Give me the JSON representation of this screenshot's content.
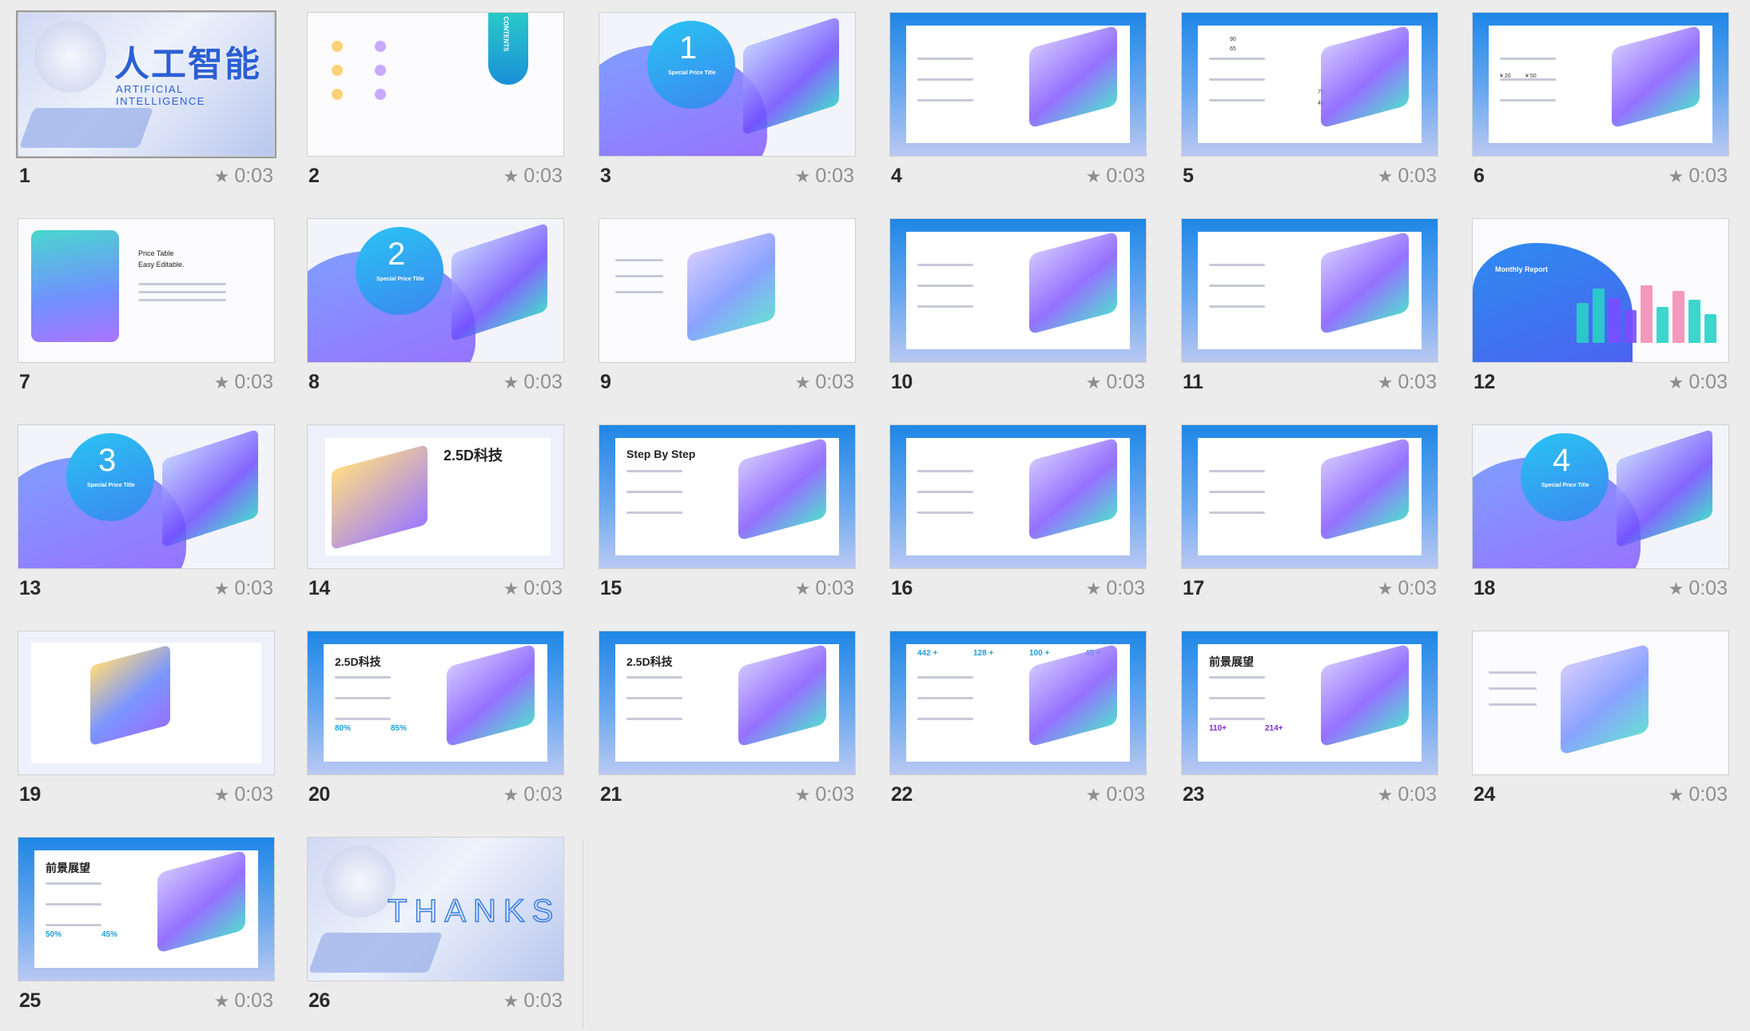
{
  "slides": [
    {
      "number": "1",
      "duration": "0:03",
      "selected": true,
      "title_cn": "人工智能",
      "title_en": "ARTIFICIAL INTELLIGENCE"
    },
    {
      "number": "2",
      "duration": "0:03",
      "contents_label": "CONTENTS"
    },
    {
      "number": "3",
      "duration": "0:03",
      "section_number": "1",
      "section_title": "Special Price Title"
    },
    {
      "number": "4",
      "duration": "0:03"
    },
    {
      "number": "5",
      "duration": "0:03",
      "values": [
        "90",
        "65",
        "70",
        "45"
      ]
    },
    {
      "number": "6",
      "duration": "0:03",
      "prices": [
        "¥ 20",
        "¥ 50"
      ]
    },
    {
      "number": "7",
      "duration": "0:03",
      "heading": "Price Table",
      "subheading": "Easy Editable."
    },
    {
      "number": "8",
      "duration": "0:03",
      "section_number": "2",
      "section_title": "Special Price Title"
    },
    {
      "number": "9",
      "duration": "0:03"
    },
    {
      "number": "10",
      "duration": "0:03"
    },
    {
      "number": "11",
      "duration": "0:03"
    },
    {
      "number": "12",
      "duration": "0:03",
      "heading": "Monthly Report"
    },
    {
      "number": "13",
      "duration": "0:03",
      "section_number": "3",
      "section_title": "Special Price Title"
    },
    {
      "number": "14",
      "duration": "0:03",
      "heading": "2.5D科技"
    },
    {
      "number": "15",
      "duration": "0:03",
      "heading": "Step By Step"
    },
    {
      "number": "16",
      "duration": "0:03"
    },
    {
      "number": "17",
      "duration": "0:03"
    },
    {
      "number": "18",
      "duration": "0:03",
      "section_number": "4",
      "section_title": "Special Price Title"
    },
    {
      "number": "19",
      "duration": "0:03"
    },
    {
      "number": "20",
      "duration": "0:03",
      "heading": "2.5D科技",
      "stats": [
        "80%",
        "85%"
      ]
    },
    {
      "number": "21",
      "duration": "0:03",
      "heading": "2.5D科技"
    },
    {
      "number": "22",
      "duration": "0:03",
      "stats": [
        "442 +",
        "128 +",
        "100 +",
        "45 +"
      ]
    },
    {
      "number": "23",
      "duration": "0:03",
      "heading": "前景展望",
      "stats": [
        "110+",
        "214+"
      ]
    },
    {
      "number": "24",
      "duration": "0:03"
    },
    {
      "number": "25",
      "duration": "0:03",
      "heading": "前景展望",
      "stats": [
        "50%",
        "45%"
      ]
    },
    {
      "number": "26",
      "duration": "0:03",
      "thanks": "THANKS"
    }
  ],
  "icons": {
    "duration": "star-icon"
  },
  "colors": {
    "accent_blue": "#1e87e6",
    "accent_purple": "#7b4dff",
    "accent_teal": "#27c6c9",
    "selection_border": "#9a9a9a"
  }
}
